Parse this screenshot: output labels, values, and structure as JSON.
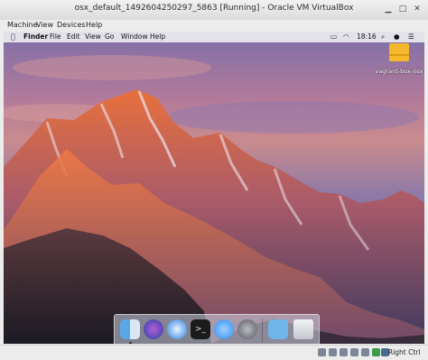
{
  "window": {
    "title": "osx_default_1492604250297_5863 [Running] - Oracle VM VirtualBox",
    "controls": [
      "minimize",
      "maximize",
      "close"
    ]
  },
  "vbox_menu": [
    "Machine",
    "View",
    "Devices",
    "Help"
  ],
  "guest_menubar": {
    "apple_icon": "apple-icon",
    "items": [
      "Finder",
      "File",
      "Edit",
      "View",
      "Go",
      "Window",
      "Help"
    ],
    "clock": "18:16",
    "status_icons": [
      "screen-mirroring-icon",
      "wifi-icon",
      "spotlight-icon",
      "siri-icon",
      "notification-center-icon"
    ]
  },
  "desktop": {
    "icon_label": "vagrant-box-osx"
  },
  "dock": {
    "items": [
      "finder-icon",
      "siri-icon",
      "safari-icon",
      "terminal-icon",
      "messages-icon",
      "system-preferences-icon",
      "downloads-folder-icon",
      "trash-icon"
    ]
  },
  "statusbar": {
    "host_key": "Right Ctrl"
  },
  "colors": {
    "titlebar": "#dcdcdc",
    "peak_orange": "#e0643a",
    "folder_yellow": "#f5b82a"
  }
}
